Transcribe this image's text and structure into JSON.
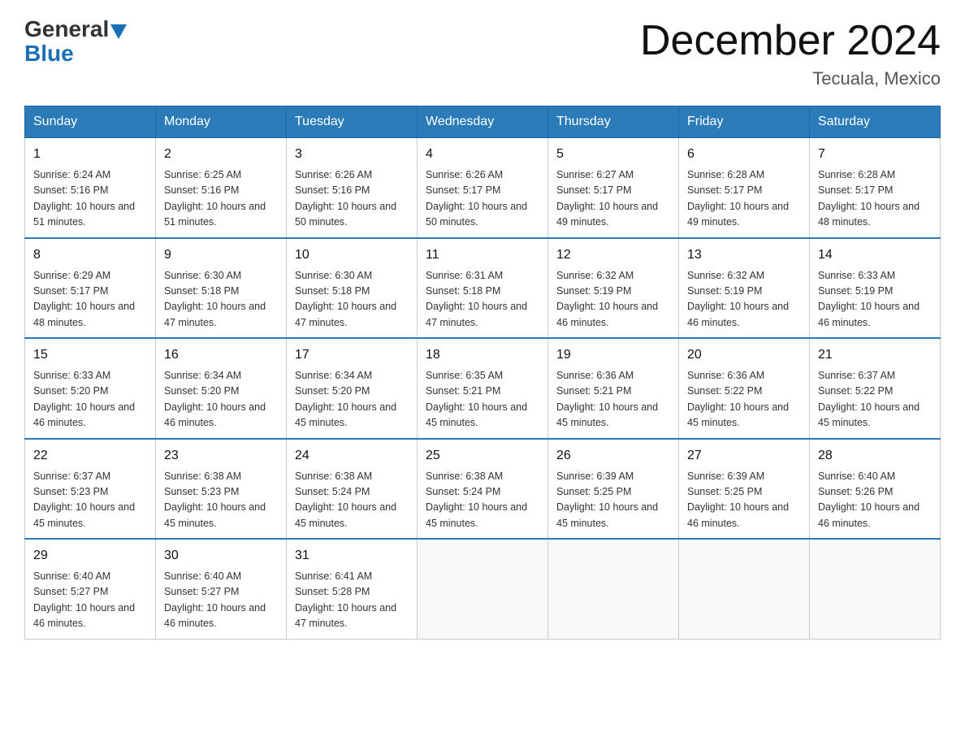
{
  "header": {
    "logo_general": "General",
    "logo_blue": "Blue",
    "month_title": "December 2024",
    "location": "Tecuala, Mexico"
  },
  "days_of_week": [
    "Sunday",
    "Monday",
    "Tuesday",
    "Wednesday",
    "Thursday",
    "Friday",
    "Saturday"
  ],
  "weeks": [
    [
      {
        "day": "1",
        "sunrise": "6:24 AM",
        "sunset": "5:16 PM",
        "daylight": "10 hours and 51 minutes."
      },
      {
        "day": "2",
        "sunrise": "6:25 AM",
        "sunset": "5:16 PM",
        "daylight": "10 hours and 51 minutes."
      },
      {
        "day": "3",
        "sunrise": "6:26 AM",
        "sunset": "5:16 PM",
        "daylight": "10 hours and 50 minutes."
      },
      {
        "day": "4",
        "sunrise": "6:26 AM",
        "sunset": "5:17 PM",
        "daylight": "10 hours and 50 minutes."
      },
      {
        "day": "5",
        "sunrise": "6:27 AM",
        "sunset": "5:17 PM",
        "daylight": "10 hours and 49 minutes."
      },
      {
        "day": "6",
        "sunrise": "6:28 AM",
        "sunset": "5:17 PM",
        "daylight": "10 hours and 49 minutes."
      },
      {
        "day": "7",
        "sunrise": "6:28 AM",
        "sunset": "5:17 PM",
        "daylight": "10 hours and 48 minutes."
      }
    ],
    [
      {
        "day": "8",
        "sunrise": "6:29 AM",
        "sunset": "5:17 PM",
        "daylight": "10 hours and 48 minutes."
      },
      {
        "day": "9",
        "sunrise": "6:30 AM",
        "sunset": "5:18 PM",
        "daylight": "10 hours and 47 minutes."
      },
      {
        "day": "10",
        "sunrise": "6:30 AM",
        "sunset": "5:18 PM",
        "daylight": "10 hours and 47 minutes."
      },
      {
        "day": "11",
        "sunrise": "6:31 AM",
        "sunset": "5:18 PM",
        "daylight": "10 hours and 47 minutes."
      },
      {
        "day": "12",
        "sunrise": "6:32 AM",
        "sunset": "5:19 PM",
        "daylight": "10 hours and 46 minutes."
      },
      {
        "day": "13",
        "sunrise": "6:32 AM",
        "sunset": "5:19 PM",
        "daylight": "10 hours and 46 minutes."
      },
      {
        "day": "14",
        "sunrise": "6:33 AM",
        "sunset": "5:19 PM",
        "daylight": "10 hours and 46 minutes."
      }
    ],
    [
      {
        "day": "15",
        "sunrise": "6:33 AM",
        "sunset": "5:20 PM",
        "daylight": "10 hours and 46 minutes."
      },
      {
        "day": "16",
        "sunrise": "6:34 AM",
        "sunset": "5:20 PM",
        "daylight": "10 hours and 46 minutes."
      },
      {
        "day": "17",
        "sunrise": "6:34 AM",
        "sunset": "5:20 PM",
        "daylight": "10 hours and 45 minutes."
      },
      {
        "day": "18",
        "sunrise": "6:35 AM",
        "sunset": "5:21 PM",
        "daylight": "10 hours and 45 minutes."
      },
      {
        "day": "19",
        "sunrise": "6:36 AM",
        "sunset": "5:21 PM",
        "daylight": "10 hours and 45 minutes."
      },
      {
        "day": "20",
        "sunrise": "6:36 AM",
        "sunset": "5:22 PM",
        "daylight": "10 hours and 45 minutes."
      },
      {
        "day": "21",
        "sunrise": "6:37 AM",
        "sunset": "5:22 PM",
        "daylight": "10 hours and 45 minutes."
      }
    ],
    [
      {
        "day": "22",
        "sunrise": "6:37 AM",
        "sunset": "5:23 PM",
        "daylight": "10 hours and 45 minutes."
      },
      {
        "day": "23",
        "sunrise": "6:38 AM",
        "sunset": "5:23 PM",
        "daylight": "10 hours and 45 minutes."
      },
      {
        "day": "24",
        "sunrise": "6:38 AM",
        "sunset": "5:24 PM",
        "daylight": "10 hours and 45 minutes."
      },
      {
        "day": "25",
        "sunrise": "6:38 AM",
        "sunset": "5:24 PM",
        "daylight": "10 hours and 45 minutes."
      },
      {
        "day": "26",
        "sunrise": "6:39 AM",
        "sunset": "5:25 PM",
        "daylight": "10 hours and 45 minutes."
      },
      {
        "day": "27",
        "sunrise": "6:39 AM",
        "sunset": "5:25 PM",
        "daylight": "10 hours and 46 minutes."
      },
      {
        "day": "28",
        "sunrise": "6:40 AM",
        "sunset": "5:26 PM",
        "daylight": "10 hours and 46 minutes."
      }
    ],
    [
      {
        "day": "29",
        "sunrise": "6:40 AM",
        "sunset": "5:27 PM",
        "daylight": "10 hours and 46 minutes."
      },
      {
        "day": "30",
        "sunrise": "6:40 AM",
        "sunset": "5:27 PM",
        "daylight": "10 hours and 46 minutes."
      },
      {
        "day": "31",
        "sunrise": "6:41 AM",
        "sunset": "5:28 PM",
        "daylight": "10 hours and 47 minutes."
      },
      null,
      null,
      null,
      null
    ]
  ]
}
